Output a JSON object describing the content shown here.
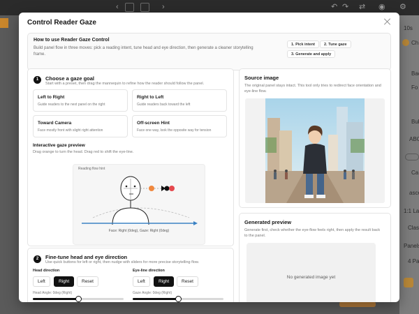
{
  "modal": {
    "title": "Control Reader Gaze"
  },
  "howto": {
    "title": "How to use Reader Gaze Control",
    "description": "Build panel flow in three moves: pick a reading intent, tune head and eye direction, then generate a cleaner storytelling frame.",
    "steps": [
      "1. Pick intent",
      "2. Tune gaze",
      "3. Generate and apply"
    ]
  },
  "goal": {
    "number": "1",
    "title": "Choose a gaze goal",
    "description": "Start with a preset, then drag the mannequin to refine how the reader should follow the panel.",
    "presets": [
      {
        "title": "Left to Right",
        "desc": "Guide readers to the next panel on the right"
      },
      {
        "title": "Right to Left",
        "desc": "Guide readers back toward the left"
      },
      {
        "title": "Toward Camera",
        "desc": "Face mostly front with slight right attention"
      },
      {
        "title": "Off-screen Hint",
        "desc": "Face one way, look the opposite way for tension"
      }
    ]
  },
  "gaze_preview": {
    "title": "Interactive gaze preview",
    "description": "Drag orange to turn the head. Drag red to shift the eye-line.",
    "hint": "Reading flow hint",
    "status": "Face: Right (0deg), Gaze: Right (0deg)"
  },
  "finetune": {
    "number": "2",
    "title": "Fine-tune head and eye direction",
    "description": "Use quick buttons for left or right, then nudge with sliders for more precise storytelling flow.",
    "head": {
      "label": "Head direction",
      "buttons": [
        "Left",
        "Right",
        "Reset"
      ],
      "active": "Right",
      "angle_label": "Head Angle: 0deg (Right)",
      "value": 0.5
    },
    "eye": {
      "label": "Eye-line direction",
      "buttons": [
        "Left",
        "Right",
        "Reset"
      ],
      "active": "Right",
      "angle_label": "Gaze Angle: 0deg (Right)",
      "value": 0.5
    }
  },
  "source": {
    "title": "Source image",
    "description": "The original panel stays intact. This tool only tries to redirect face orientation and eye-line flow."
  },
  "generated": {
    "title": "Generated preview",
    "description": "Generate first, check whether the eye-flow feels right, then apply the result back to the panel.",
    "placeholder": "No generated image yet"
  },
  "background": {
    "right_labels": [
      "10s",
      "Ch",
      "Bac",
      "Fo",
      "Bub",
      "ABC",
      "Ca",
      "asce",
      "1:1 Lay",
      "Class",
      "Panels",
      "4 Pan"
    ]
  },
  "colors": {
    "accent_orange": "#f0883e",
    "accent_red": "#e5484d",
    "guide_blue": "#3b82c4",
    "active_button": "#111111"
  }
}
